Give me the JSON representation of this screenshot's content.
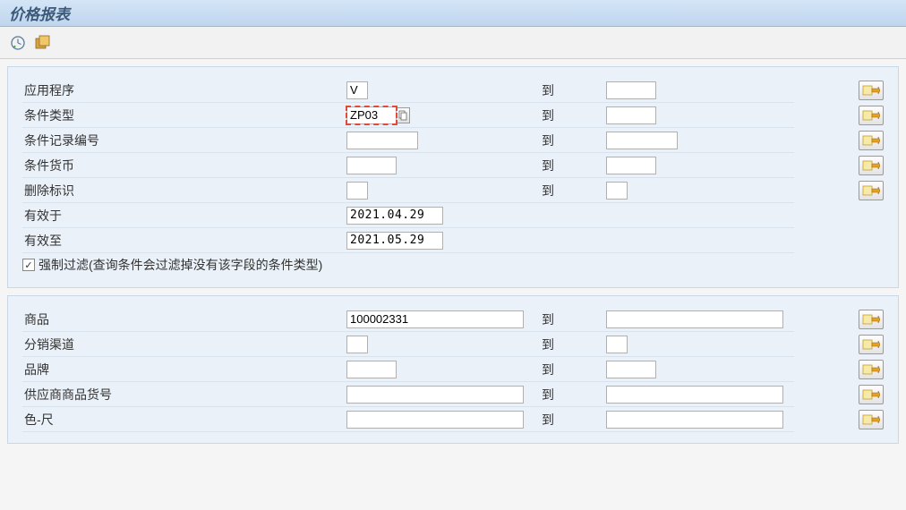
{
  "title": "价格报表",
  "toLabel": "到",
  "section1": {
    "rows": [
      {
        "label": "应用程序",
        "fromValue": "V",
        "toValue": "",
        "fromSize": "tiny",
        "toSize": "small",
        "hasTo": true,
        "hasRange": true
      },
      {
        "label": "条件类型",
        "fromValue": "ZP03",
        "toValue": "",
        "fromSize": "small",
        "toSize": "small",
        "hasTo": true,
        "hasRange": true,
        "highlight": true,
        "f4": true
      },
      {
        "label": "条件记录编号",
        "fromValue": "",
        "toValue": "",
        "fromSize": "mid",
        "toSize": "mid",
        "hasTo": true,
        "hasRange": true
      },
      {
        "label": "条件货币",
        "fromValue": "",
        "toValue": "",
        "fromSize": "small",
        "toSize": "small",
        "hasTo": true,
        "hasRange": true
      },
      {
        "label": "删除标识",
        "fromValue": "",
        "toValue": "",
        "fromSize": "tiny",
        "toSize": "tiny",
        "hasTo": true,
        "hasRange": true
      },
      {
        "label": "有效于",
        "fromValue": "2021.04.29",
        "fromSize": "date",
        "hasTo": false,
        "hasRange": false
      },
      {
        "label": "有效至",
        "fromValue": "2021.05.29",
        "fromSize": "date",
        "hasTo": false,
        "hasRange": false
      }
    ],
    "checkbox": {
      "checked": true,
      "label": "强制过滤(查询条件会过滤掉没有该字段的条件类型)"
    }
  },
  "section2": {
    "rows": [
      {
        "label": "商品",
        "fromValue": "100002331",
        "toValue": "",
        "fromSize": "wide",
        "toSize": "wide",
        "hasTo": true,
        "hasRange": true
      },
      {
        "label": "分销渠道",
        "fromValue": "",
        "toValue": "",
        "fromSize": "tiny",
        "toSize": "tiny",
        "hasTo": true,
        "hasRange": true
      },
      {
        "label": "品牌",
        "fromValue": "",
        "toValue": "",
        "fromSize": "small",
        "toSize": "small",
        "hasTo": true,
        "hasRange": true
      },
      {
        "label": "供应商商品货号",
        "fromValue": "",
        "toValue": "",
        "fromSize": "wide",
        "toSize": "wide",
        "hasTo": true,
        "hasRange": true
      },
      {
        "label": "色-尺",
        "fromValue": "",
        "toValue": "",
        "fromSize": "wide",
        "toSize": "wide",
        "hasTo": true,
        "hasRange": true
      }
    ]
  }
}
